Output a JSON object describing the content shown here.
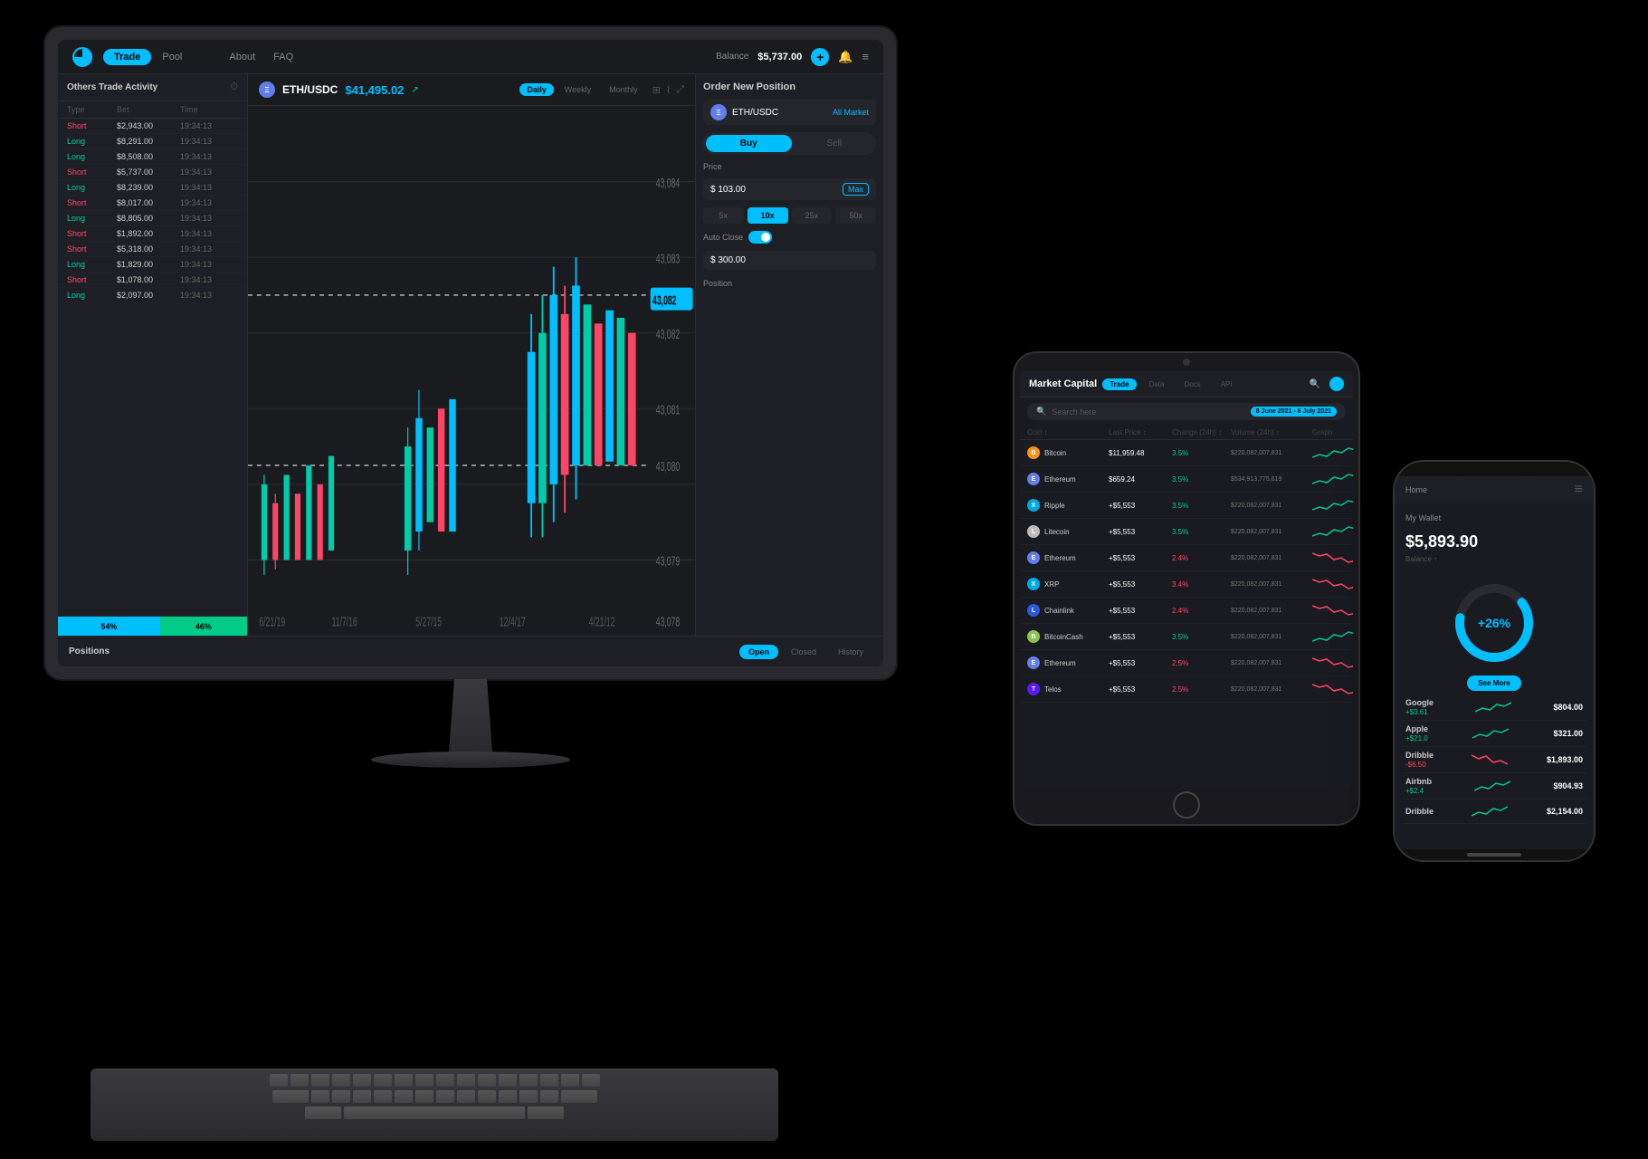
{
  "monitor": {
    "header": {
      "logo": "◉",
      "trade_label": "Trade",
      "pool_label": "Pool",
      "about_label": "About",
      "faq_label": "FAQ",
      "balance_label": "Balance",
      "balance_amount": "$5,737.00",
      "plus_icon": "+",
      "bell_icon": "🔔",
      "menu_icon": "≡"
    },
    "left_panel": {
      "title": "Others Trade Activity",
      "clock_icon": "⏰",
      "columns": [
        "Type",
        "Bet",
        "Time"
      ],
      "rows": [
        {
          "type": "Short",
          "bet": "$2,943.00",
          "time": "19:34:13",
          "is_short": true
        },
        {
          "type": "Long",
          "bet": "$8,291.00",
          "time": "19:34:13",
          "is_short": false
        },
        {
          "type": "Long",
          "bet": "$8,508.00",
          "time": "19:34:13",
          "is_short": false
        },
        {
          "type": "Short",
          "bet": "$5,737.00",
          "time": "19:34:13",
          "is_short": true
        },
        {
          "type": "Long",
          "bet": "$8,239.00",
          "time": "19:34:13",
          "is_short": false
        },
        {
          "type": "Short",
          "bet": "$8,017.00",
          "time": "19:34:13",
          "is_short": true
        },
        {
          "type": "Long",
          "bet": "$8,805.00",
          "time": "19:34:13",
          "is_short": false
        },
        {
          "type": "Short",
          "bet": "$1,892.00",
          "time": "19:34:13",
          "is_short": true
        },
        {
          "type": "Short",
          "bet": "$5,318.00",
          "time": "19:34:13",
          "is_short": true
        },
        {
          "type": "Long",
          "bet": "$1,829.00",
          "time": "19:34:13",
          "is_short": false
        },
        {
          "type": "Short",
          "bet": "$1,078.00",
          "time": "19:34:13",
          "is_short": true
        },
        {
          "type": "Long",
          "bet": "$2,097.00",
          "time": "19:34:13",
          "is_short": false
        }
      ],
      "progress_short": "54%",
      "progress_long": "46%",
      "short_pct": 54,
      "long_pct": 46
    },
    "chart": {
      "pair": "ETH/USDC",
      "price": "$41,495.02",
      "up_icon": "↗",
      "timeframes": [
        "Daily",
        "Weekly",
        "Monthly"
      ],
      "active_tf": "Daily",
      "labels": [
        "6/21/19",
        "11/7/16",
        "5/27/15",
        "12/4/17",
        "4/21/12"
      ],
      "price_levels": [
        "43,084",
        "43,083",
        "43,082",
        "43,081",
        "43,080",
        "43,079",
        "43,078"
      ],
      "current_price": "43,082",
      "dashed_line_1": "43,082",
      "dashed_line_2": "43,080"
    },
    "order_panel": {
      "title": "Order New Position",
      "pair": "ETH/USDC",
      "market": "All Market",
      "buy_label": "Buy",
      "sell_label": "Sell",
      "price_label": "Price",
      "price_value": "$ 103.00",
      "max_label": "Max",
      "leverages": [
        "5x",
        "10x",
        "25x",
        "50x"
      ],
      "active_lev": "10x",
      "auto_close_label": "Auto Close",
      "auto_close_value": "$ 300.00",
      "position_label": "Position"
    },
    "positions": {
      "title": "Positions",
      "tabs": [
        "Open",
        "Closed",
        "History"
      ],
      "active_tab": "Open"
    }
  },
  "tablet": {
    "title": "Market Capital",
    "tabs": [
      "Trade",
      "Data",
      "Docs",
      "API"
    ],
    "active_tab": "Trade",
    "search_placeholder": "Search here",
    "date_range": "8 June 2021 - 6 July 2021",
    "columns": [
      "Coin",
      "Last Price",
      "Change (24h)",
      "Volume (24h)",
      "Graph"
    ],
    "coins": [
      {
        "name": "Bitcoin",
        "symbol": "BTC",
        "color": "#f7931a",
        "price": "$11,959.48",
        "change": "3.5%",
        "positive": true,
        "volume": "$220,082,007,831"
      },
      {
        "name": "Ethereum",
        "symbol": "ETH",
        "color": "#627eea",
        "price": "$659.24",
        "change": "3.5%",
        "positive": true,
        "volume": "$534,913,775,619"
      },
      {
        "name": "Ripple",
        "symbol": "XRP",
        "color": "#00aae4",
        "price": "+$5,553",
        "change": "3.5%",
        "positive": true,
        "volume": "$220,082,007,831"
      },
      {
        "name": "Litecoin",
        "symbol": "LTC",
        "color": "#bfbbbb",
        "price": "+$5,553",
        "change": "3.5%",
        "positive": true,
        "volume": "$220,082,007,831"
      },
      {
        "name": "Ethereum",
        "symbol": "ETH",
        "color": "#627eea",
        "price": "+$5,553",
        "change": "2.4%",
        "positive": false,
        "volume": "$220,082,007,831"
      },
      {
        "name": "XRP",
        "symbol": "XRP",
        "color": "#00aae4",
        "price": "+$5,553",
        "change": "3.4%",
        "positive": false,
        "volume": "$220,082,007,831"
      },
      {
        "name": "Chainlink",
        "symbol": "LINK",
        "color": "#2a5ada",
        "price": "+$5,553",
        "change": "2.4%",
        "positive": false,
        "volume": "$220,082,007,831"
      },
      {
        "name": "BitcoinCash",
        "symbol": "BCH",
        "color": "#8dc351",
        "price": "+$5,553",
        "change": "3.5%",
        "positive": true,
        "volume": "$220,082,007,831"
      },
      {
        "name": "Ethereum",
        "symbol": "ETH",
        "color": "#627eea",
        "price": "+$5,553",
        "change": "2.5%",
        "positive": false,
        "volume": "$220,082,007,831"
      },
      {
        "name": "Telos",
        "symbol": "TLOS",
        "color": "#571aff",
        "price": "+$5,553",
        "change": "2.5%",
        "positive": false,
        "volume": "$220,082,007,831"
      }
    ]
  },
  "phone": {
    "home_label": "Home",
    "wallet_title": "My Wallet",
    "balance": "$5,893.90",
    "balance_sub": "Balance ↑",
    "donut_pct": "+26%",
    "see_more": "See More",
    "items": [
      {
        "name": "Google",
        "change": "+$3.61",
        "positive": true,
        "value": "$804.00"
      },
      {
        "name": "Apple",
        "change": "+$21.0",
        "positive": true,
        "value": "$321.00"
      },
      {
        "name": "Dribble",
        "change": "-$6.50",
        "positive": false,
        "value": "$1,893.00"
      },
      {
        "name": "Airbnb",
        "change": "+$2.4",
        "positive": true,
        "value": "$904.93"
      },
      {
        "name": "Dribble",
        "change": "",
        "positive": true,
        "value": "$2,154.00"
      }
    ]
  }
}
